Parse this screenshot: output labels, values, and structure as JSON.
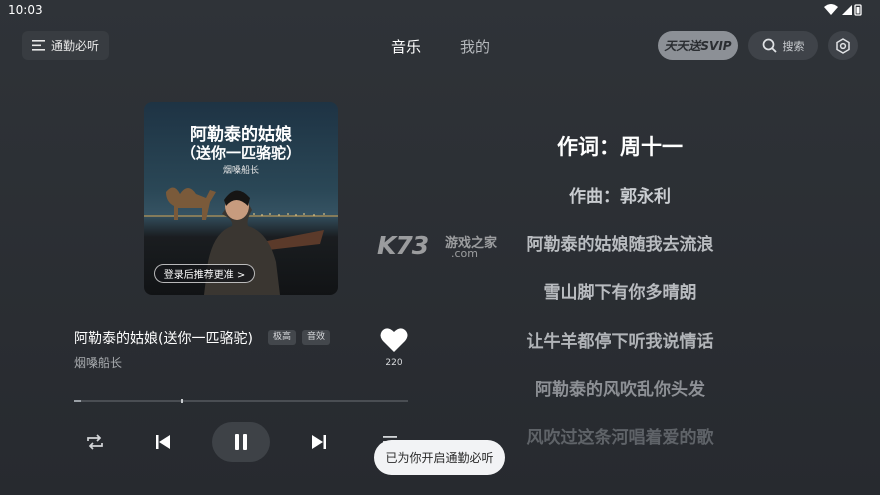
{
  "status_bar": {
    "time": "10:03"
  },
  "header": {
    "commute_label": "通勤必听",
    "tabs": [
      {
        "label": "音乐",
        "active": true
      },
      {
        "label": "我的",
        "active": false
      }
    ],
    "svip_label": "天天送SVIP",
    "search_label": "搜索"
  },
  "cover": {
    "title": "阿勒泰的姑娘",
    "subtitle": "（送你一匹骆驼）",
    "artist": "烟嗓船长",
    "login_prompt": "登录后推荐更准 >"
  },
  "song": {
    "title": "阿勒泰的姑娘(送你一匹骆驼)",
    "badge_quality": "极高",
    "badge_effect": "音效",
    "artist": "烟嗓船长",
    "like_count": "220",
    "progress_fraction": 0.02,
    "buffer_fraction": 0.32
  },
  "lyrics": [
    {
      "text": "作词：周十一",
      "emphasis": "current"
    },
    {
      "text": "作曲：郭永利",
      "emphasis": "near"
    },
    {
      "text": "阿勒泰的姑娘随我去流浪",
      "emphasis": "normal"
    },
    {
      "text": "雪山脚下有你多晴朗",
      "emphasis": "normal"
    },
    {
      "text": "让牛羊都停下听我说情话",
      "emphasis": "normal"
    },
    {
      "text": "阿勒泰的风吹乱你头发",
      "emphasis": "fade"
    },
    {
      "text": "风吹过这条河唱着爱的歌",
      "emphasis": "faint"
    }
  ],
  "watermark": {
    "brand": "K73",
    "name": "游戏之家",
    "domain": ".com"
  },
  "toast": "已为你开启通勤必听",
  "colors": {
    "background": "#2b2e33",
    "accent": "#ffffff",
    "svip": "#8c9096"
  }
}
